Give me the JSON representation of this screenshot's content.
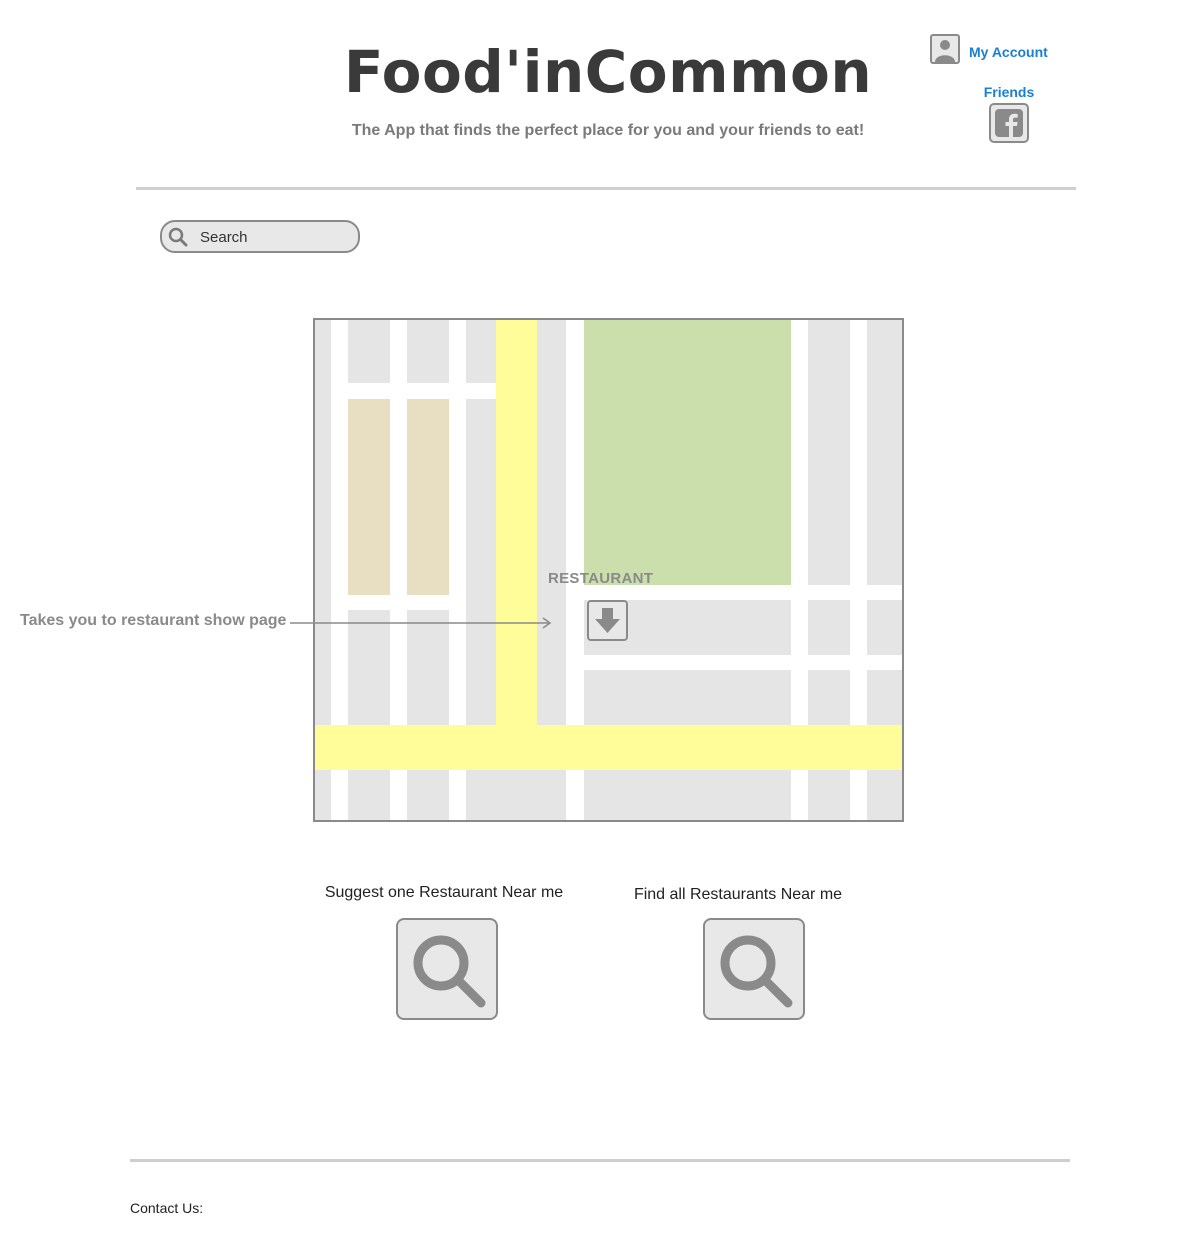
{
  "header": {
    "app_title": "Food'inCommon",
    "tagline": "The App that finds the perfect place for you and your friends to eat!",
    "account_label": "My Account",
    "friends_label": "Friends"
  },
  "search": {
    "placeholder": "Search"
  },
  "map": {
    "marker_label": "RESTAURANT"
  },
  "annotation": {
    "text": "Takes you to restaurant show page"
  },
  "actions": [
    {
      "label": "Suggest one Restaurant Near me",
      "icon": "search-icon"
    },
    {
      "label": "Find all Restaurants Near me",
      "icon": "search-icon"
    }
  ],
  "footer": {
    "contact_label": "Contact Us:"
  },
  "colors": {
    "link": "#1a7fd4",
    "road": "#fffd99",
    "park": "#cbdfac",
    "building": "#e6e5e5",
    "highlight_block": "#e8dfc3"
  }
}
